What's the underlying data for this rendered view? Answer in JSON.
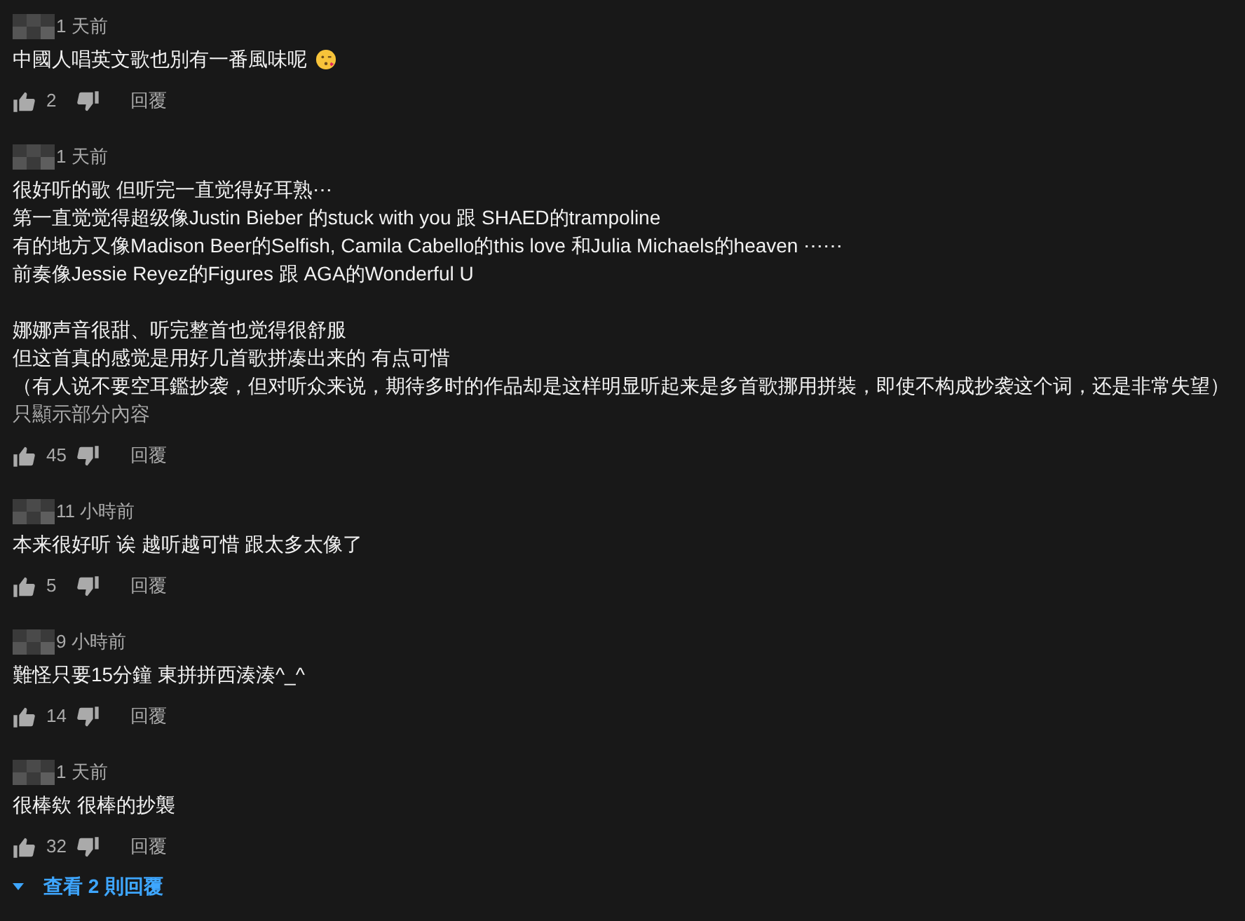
{
  "comments": [
    {
      "time": "1 天前",
      "paragraphs": [
        [
          "中國人唱英文歌也別有一番風味呢"
        ]
      ],
      "emoji": true,
      "likes": "2",
      "reply": "回覆"
    },
    {
      "time": "1 天前",
      "paragraphs": [
        [
          "很好听的歌 但听完一直觉得好耳熟⋯",
          "第一直觉觉得超级像Justin Bieber 的stuck with you 跟 SHAED的trampoline",
          "有的地方又像Madison Beer的Selfish, Camila Cabello的this love 和Julia Michaels的heaven ⋯⋯",
          "前奏像Jessie Reyez的Figures 跟 AGA的Wonderful U"
        ],
        [
          "娜娜声音很甜、听完整首也觉得很舒服",
          "但这首真的感觉是用好几首歌拼凑出来的 有点可惜",
          "（有人说不要空耳鑑抄袭，但对听众来说，期待多时的作品却是这样明显听起来是多首歌挪用拼裝，即使不构成抄袭这个词，还是非常失望）"
        ]
      ],
      "emoji": false,
      "show_less": "只顯示部分內容",
      "likes": "45",
      "reply": "回覆"
    },
    {
      "time": "11 小時前",
      "paragraphs": [
        [
          "本来很好听 诶 越听越可惜 跟太多太像了"
        ]
      ],
      "emoji": false,
      "likes": "5",
      "reply": "回覆"
    },
    {
      "time": "9 小時前",
      "paragraphs": [
        [
          "難怪只要15分鐘 東拼拼西湊湊^_^"
        ]
      ],
      "emoji": false,
      "likes": "14",
      "reply": "回覆"
    },
    {
      "time": "1 天前",
      "paragraphs": [
        [
          "很棒欸 很棒的抄襲"
        ]
      ],
      "emoji": false,
      "likes": "32",
      "reply": "回覆",
      "view_replies": "查看 2 則回覆"
    }
  ]
}
